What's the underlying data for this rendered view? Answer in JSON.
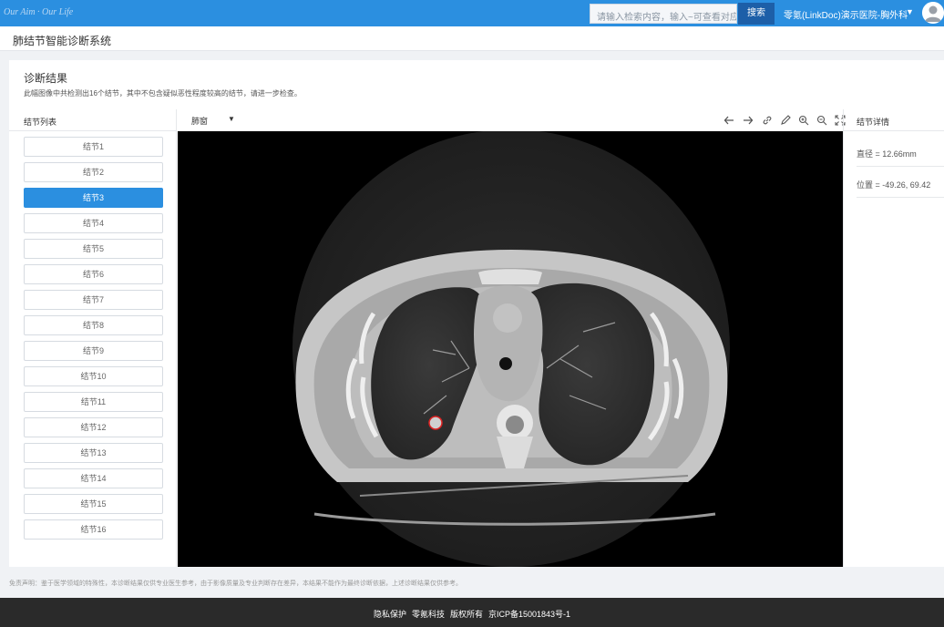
{
  "topbar": {
    "brand": "Our Aim · Our Life",
    "search_placeholder": "请输入检索内容，输入~可查看对应的",
    "search_button": "搜索",
    "user_name": "零氪(LinkDoc)演示医院-胸外科",
    "user_caret": "▼"
  },
  "header": {
    "title": "肺结节智能诊断系统"
  },
  "result": {
    "title": "诊断结果",
    "description": "此幅图像中共检测出16个结节，其中不包含疑似恶性程度较高的结节，请进一步检查。"
  },
  "node_list": {
    "heading": "结节列表",
    "selected_index": 2,
    "items": [
      "结节1",
      "结节2",
      "结节3",
      "结节4",
      "结节5",
      "结节6",
      "结节7",
      "结节8",
      "结节9",
      "结节10",
      "结节11",
      "结节12",
      "结节13",
      "结节14",
      "结节15",
      "结节16"
    ]
  },
  "viewer": {
    "window_preset": "肺窗",
    "window_caret": "▼",
    "tools": [
      "arrow-left-icon",
      "arrow-right-icon",
      "link-icon",
      "pen-icon",
      "zoom-in-icon",
      "zoom-out-icon",
      "fullscreen-icon"
    ]
  },
  "details": {
    "heading": "结节详情",
    "diameter": "直径 = 12.66mm",
    "position": "位置 = -49.26, 69.42"
  },
  "disclaimer": "免责声明：鉴于医学领域的特殊性，本诊断结果仅供专业医生参考，由于影像质量及专业判断存在差异，本结果不能作为最终诊断依据，上述诊断结果仅供参考。",
  "footer": {
    "links": [
      "隐私保护",
      "零氪科技",
      "版权所有",
      "京ICP备15001843号-1"
    ]
  },
  "colors": {
    "primary": "#2b8fe0",
    "footer_bg": "#2a2a2a"
  }
}
